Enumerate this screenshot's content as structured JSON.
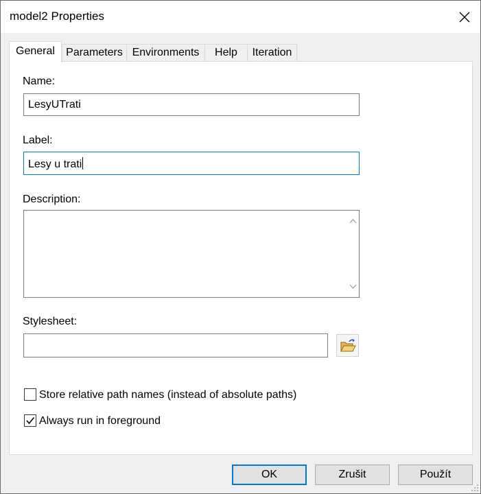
{
  "window": {
    "title": "model2 Properties"
  },
  "tabs": [
    {
      "label": "General",
      "active": true
    },
    {
      "label": "Parameters",
      "active": false
    },
    {
      "label": "Environments",
      "active": false
    },
    {
      "label": "Help",
      "active": false
    },
    {
      "label": "Iteration",
      "active": false
    }
  ],
  "general": {
    "name_label": "Name:",
    "name_value": "LesyUTrati",
    "label_label": "Label:",
    "label_value": "Lesy u trati",
    "description_label": "Description:",
    "description_value": "",
    "stylesheet_label": "Stylesheet:",
    "stylesheet_value": "",
    "relative_paths_label": "Store relative path names (instead of absolute paths)",
    "relative_paths_checked": false,
    "foreground_label": "Always run in foreground",
    "foreground_checked": true
  },
  "buttons": {
    "ok": "OK",
    "cancel": "Zrušit",
    "apply": "Použít"
  },
  "icons": {
    "close": "close-icon",
    "browse": "folder-open-icon",
    "scroll_up": "chevron-up-icon",
    "scroll_down": "chevron-down-icon",
    "check": "checkmark-icon"
  },
  "colors": {
    "focus_border": "#0078d7",
    "panel_bg": "#ffffff",
    "dialog_bg": "#f0f0f0"
  }
}
